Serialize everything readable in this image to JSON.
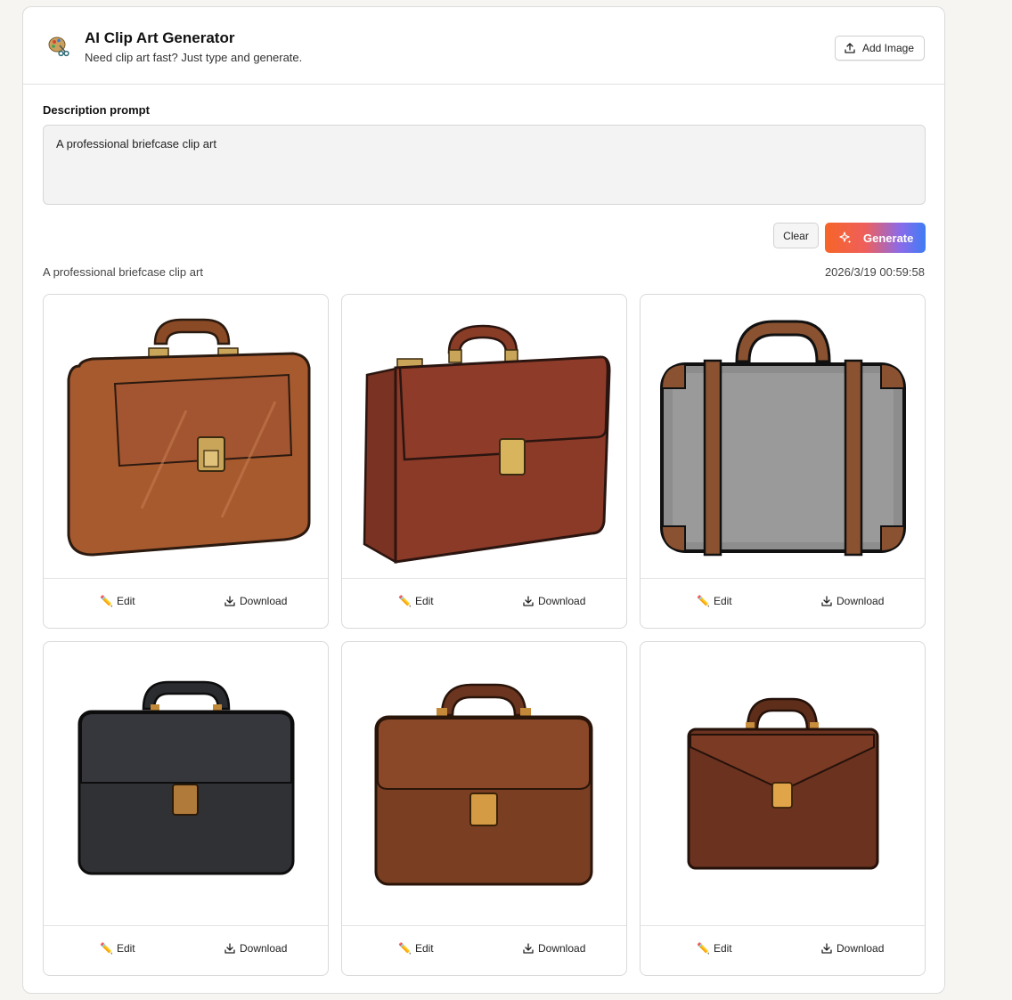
{
  "header": {
    "title": "AI Clip Art Generator",
    "subtitle": "Need clip art fast? Just type and generate.",
    "add_image_label": "Add Image"
  },
  "prompt": {
    "label": "Description prompt",
    "value": "A professional briefcase clip art"
  },
  "actions": {
    "clear_label": "Clear",
    "generate_label": "Generate"
  },
  "results": {
    "prompt": "A professional briefcase clip art",
    "timestamp": "2026/3/19 00:59:58",
    "cards": [
      {
        "style": "brown-sketch",
        "edit_label": "Edit",
        "download_label": "Download"
      },
      {
        "style": "brown-glossy",
        "edit_label": "Edit",
        "download_label": "Download"
      },
      {
        "style": "gray-suitcase",
        "edit_label": "Edit",
        "download_label": "Download"
      },
      {
        "style": "black-leather",
        "edit_label": "Edit",
        "download_label": "Download"
      },
      {
        "style": "brown-classic",
        "edit_label": "Edit",
        "download_label": "Download"
      },
      {
        "style": "dark-brown-envelope",
        "edit_label": "Edit",
        "download_label": "Download"
      }
    ]
  },
  "icons": {
    "logo": "palette-icon",
    "upload": "upload-icon",
    "sparkle": "sparkle-icon",
    "edit": "pencil-icon",
    "download": "download-icon"
  },
  "colors": {
    "accent_start": "#f66527",
    "accent_end": "#3f7cf4",
    "prompt_bg": "#f3f3f3"
  }
}
